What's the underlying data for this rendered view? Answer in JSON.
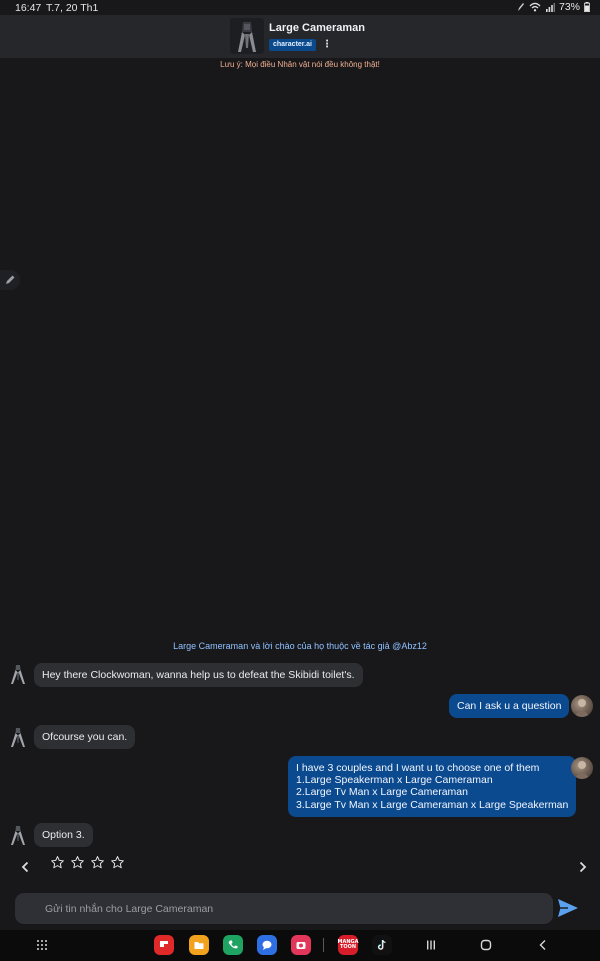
{
  "status_bar": {
    "time": "16:47",
    "date": "T.7, 20 Th1",
    "battery": "73%"
  },
  "header": {
    "character_name": "Large Cameraman",
    "brand": "character.ai",
    "avatar_icon": "cameraman-avatar",
    "menu_icon": "more-vert-icon"
  },
  "disclaimer": "Lưu ý: Mọi điều Nhân vật nói đều không thật!",
  "chat": {
    "intro_note": "Large Cameraman và lời chào của họ thuộc về tác giả @Abz12",
    "messages": [
      {
        "sender": "bot",
        "text": "Hey there Clockwoman, wanna help us to defeat the Skibidi toilet's."
      },
      {
        "sender": "user",
        "text": "Can I ask u a question"
      },
      {
        "sender": "bot",
        "text": "Ofcourse you can."
      },
      {
        "sender": "user",
        "lines": [
          "I have 3 couples and I want u to choose one of them",
          "1.Large Speakerman x Large Cameraman",
          "2.Large Tv Man x Large Cameraman",
          "3.Large Tv Man x Large Cameraman x Large Speakerman"
        ]
      },
      {
        "sender": "bot",
        "text": "Option 3."
      }
    ],
    "rating": {
      "stars_total": 4,
      "stars_filled": 0
    }
  },
  "input": {
    "placeholder": "Gửi tin nhắn cho Large Cameraman",
    "value": ""
  },
  "colors": {
    "background": "#18181b",
    "header": "#26272b",
    "user_bubble": "#0b4a8f",
    "bot_bubble": "#2e2f33",
    "accent": "#4a90e2",
    "disclaimer": "#f0b090",
    "intro_note": "#8fc2ff"
  },
  "nav_bar": {
    "apps": [
      "flipboard-icon",
      "files-icon",
      "phone-icon",
      "messages-icon",
      "camera-icon",
      "mangatoon-icon",
      "tiktok-icon"
    ],
    "mangatoon_label": [
      "MANGA",
      "TOON"
    ],
    "buttons": [
      "recents-button",
      "home-button",
      "back-button"
    ]
  }
}
